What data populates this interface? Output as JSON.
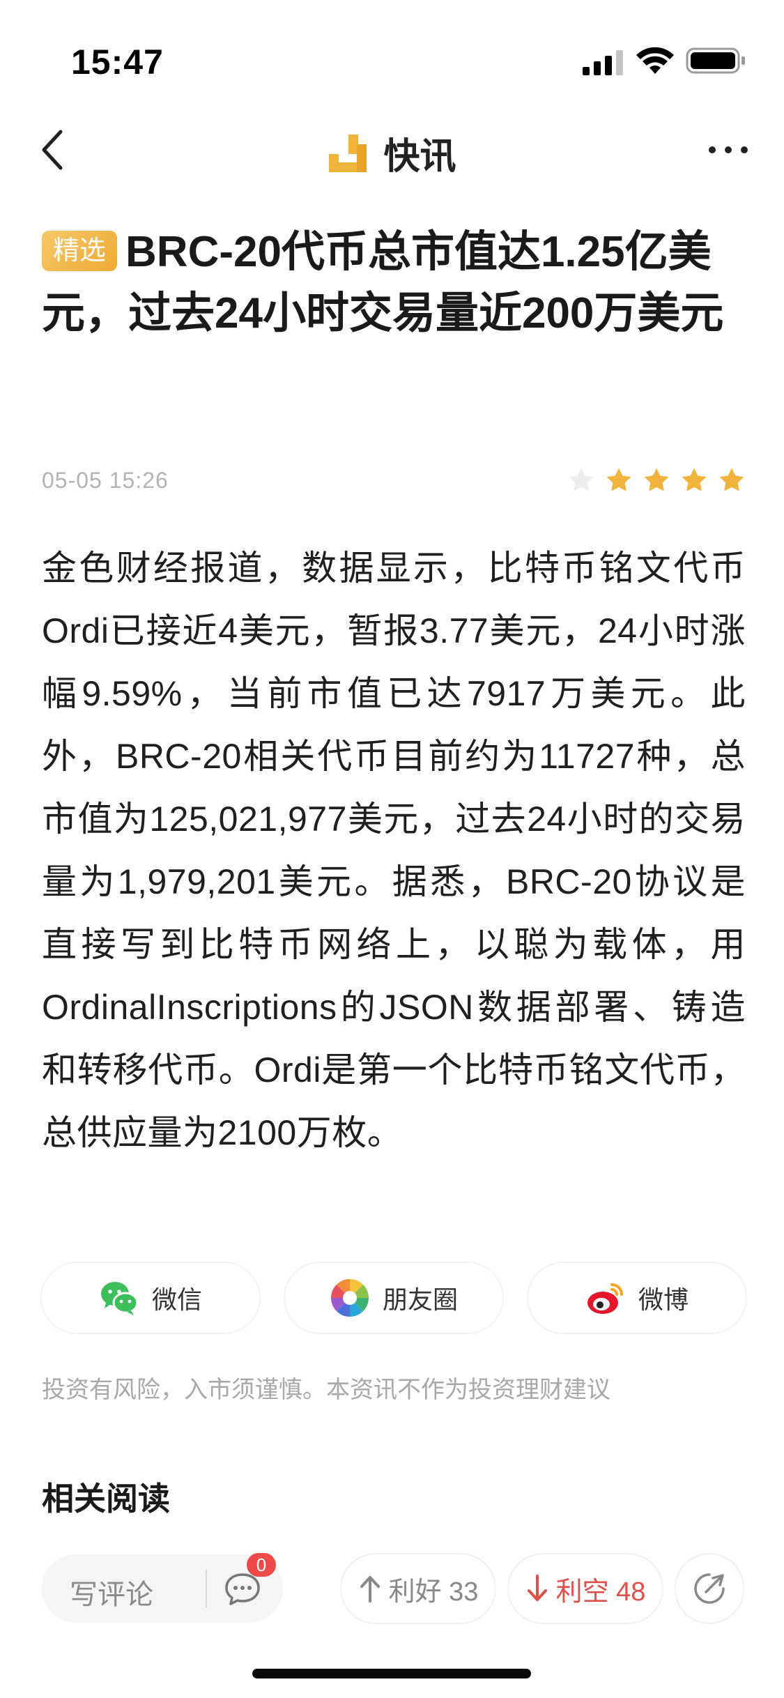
{
  "status_bar": {
    "time": "15:47"
  },
  "nav": {
    "title": "快讯"
  },
  "article": {
    "badge": "精选",
    "title": "BRC-20代币总市值达1.25亿美元，过去24小时交易量近200万美元",
    "date": "05-05 15:26",
    "rating": {
      "filled": 4,
      "total": 5
    },
    "body": "金色财经报道，数据显示，比特币铭文代币Ordi已接近4美元，暂报3.77美元，24小时涨幅9.59%，当前市值已达7917万美元。此外，BRC-20相关代币目前约为11727种，总市值为125,021,977美元，过去24小时的交易量为1,979,201美元。据悉，BRC-20协议是直接写到比特币网络上，以聪为载体，用OrdinalInscriptions的JSON数据部署、铸造和转移代币。Ordi是第一个比特币铭文代币，总供应量为2100万枚。"
  },
  "share": [
    {
      "label": "微信",
      "icon": "wechat-icon"
    },
    {
      "label": "朋友圈",
      "icon": "moments-icon"
    },
    {
      "label": "微博",
      "icon": "weibo-icon"
    }
  ],
  "disclaimer": "投资有风险，入市须谨慎。本资讯不作为投资理财建议",
  "related_title": "相关阅读",
  "bottom": {
    "comment_placeholder": "写评论",
    "comment_count": "0",
    "bullish_label": "利好 33",
    "bearish_label": "利空 48"
  },
  "colors": {
    "accent": "#f0b43c",
    "bearish": "#e0504a",
    "badge_red": "#ef4a4a"
  }
}
